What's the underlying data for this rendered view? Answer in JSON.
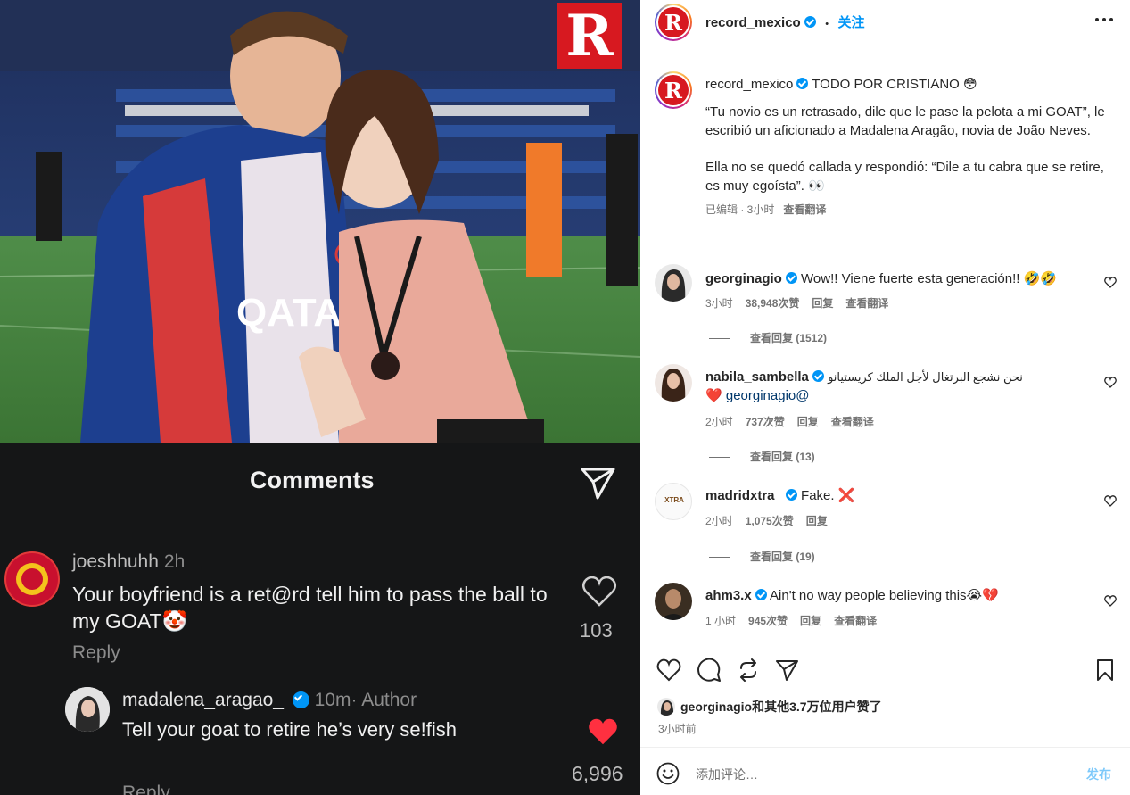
{
  "photo": {
    "logo_letter": "R"
  },
  "comments_screenshot": {
    "title": "Comments",
    "c1": {
      "user": "joeshhuhh",
      "time": "2h",
      "text": "Your boyfriend is a ret@rd tell him to pass the ball to my GOAT🤡",
      "reply": "Reply",
      "likes": "103"
    },
    "c2": {
      "user": "madalena_aragao_",
      "time": "10m",
      "tag": "· Author",
      "text": "Tell your goat to retire he’s very se!fish",
      "likes": "6,996",
      "reply": "Reply"
    }
  },
  "header": {
    "username": "record_mexico",
    "dot": "•",
    "follow": "关注"
  },
  "caption": {
    "username": "record_mexico",
    "headline": "TODO POR CRISTIANO 😳",
    "p1": "“Tu novio es un retrasado, dile que le pase la pelota a mi GOAT”, le escribió un aficionado a Madalena Aragão, novia de João Neves.",
    "p2": "Ella no se quedó callada y respondió: “Dile a tu cabra que se retire, es muy egoísta”. 👀",
    "edited": "已编辑 · 3小时",
    "translate": "查看翻译"
  },
  "comments": [
    {
      "user": "georginagio",
      "text": "Wow!! Viene fuerte esta generación!! 🤣🤣",
      "time": "3小时",
      "likes": "38,948次赞",
      "reply": "回复",
      "translate": "查看翻译",
      "replies": "查看回复 (1512)"
    },
    {
      "user": "nabila_sambella",
      "text": "نحن نشجع البرتغال لأجل الملك كريستيانو",
      "text2": "❤️",
      "mention": "georginagio@",
      "time": "2小时",
      "likes": "737次赞",
      "reply": "回复",
      "translate": "查看翻译",
      "replies": "查看回复 (13)"
    },
    {
      "user": "madridxtra_",
      "text": "Fake. ❌",
      "time": "2小时",
      "likes": "1,075次赞",
      "reply": "回复",
      "replies": "查看回复 (19)",
      "avatar_text": "XTRA"
    },
    {
      "user": "ahm3.x",
      "text": "Ain't no way people believing this😭💔",
      "time": "1 小时",
      "likes": "945次赞",
      "reply": "回复",
      "translate": "查看翻译"
    }
  ],
  "likes_line": {
    "user": "georginagio",
    "rest": "和其他3.7万位用户赞了"
  },
  "post_time": "3小时前",
  "add_comment": {
    "placeholder": "添加评论…",
    "post": "发布"
  },
  "colors": {
    "brand_red": "#d71920",
    "link": "#0095f6",
    "like_red": "#ff3040"
  }
}
